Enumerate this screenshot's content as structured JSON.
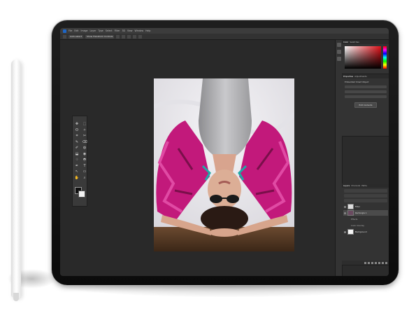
{
  "app": {
    "menu": [
      "Ps",
      "File",
      "Edit",
      "Image",
      "Layer",
      "Type",
      "Select",
      "Filter",
      "3D",
      "View",
      "Window",
      "Help"
    ]
  },
  "options_bar": {
    "tool_preset": "Auto-select",
    "mode": "Show Transform Controls"
  },
  "toolbar": {
    "tools": [
      "✥",
      "⬚",
      "ʘ",
      "✧",
      "⌗",
      "✂",
      "✎",
      "⌫",
      "✐",
      "◍",
      "⬓",
      "◉",
      "♢",
      "◓",
      "✒",
      "T",
      "↖",
      "▭",
      "✋",
      "⌕",
      "⋯",
      "…"
    ]
  },
  "right_panels": {
    "color_tabs": [
      "Color",
      "Swatches"
    ],
    "properties_tabs": [
      "Properties",
      "Adjustments"
    ],
    "properties_title": "Embedded Smart Object",
    "properties_button": "Edit Contents",
    "layers_tabs": [
      "Layers",
      "Channels",
      "Paths"
    ],
    "layers": [
      {
        "name": "Filter",
        "type": "adjust"
      },
      {
        "name": "Rectangle 1",
        "type": "photo"
      },
      {
        "name": "Effects",
        "type": "sub"
      },
      {
        "name": "Color Overlay",
        "type": "sub"
      },
      {
        "name": "Background",
        "type": "white"
      }
    ]
  },
  "colors": {
    "foreground": "#111111",
    "background": "#f2f2f2",
    "accent": "#e01018"
  }
}
